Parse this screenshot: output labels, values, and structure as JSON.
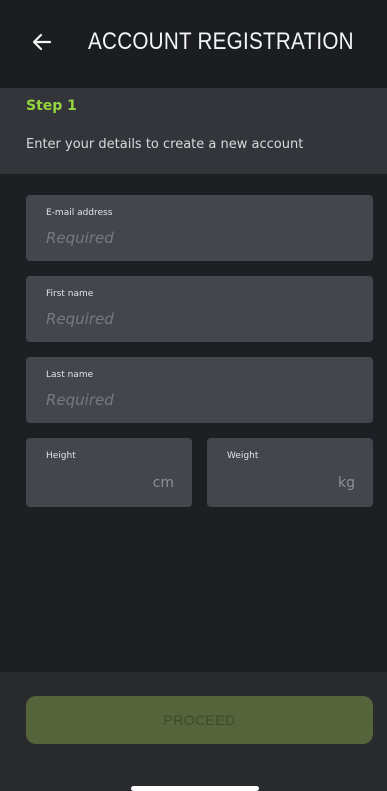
{
  "header": {
    "title": "ACCOUNT REGISTRATION",
    "back_icon": "arrow-left-icon"
  },
  "step": {
    "title": "Step 1",
    "description": "Enter your details to create a new account"
  },
  "form": {
    "email": {
      "label": "E-mail address",
      "placeholder": "Required"
    },
    "first_name": {
      "label": "First name",
      "placeholder": "Required"
    },
    "last_name": {
      "label": "Last name",
      "placeholder": "Required"
    },
    "height": {
      "label": "Height",
      "unit": "cm"
    },
    "weight": {
      "label": "Weight",
      "unit": "kg"
    }
  },
  "actions": {
    "proceed_label": "PROCEED"
  },
  "colors": {
    "accent": "#96d53e",
    "background": "#1e1f22",
    "field": "#44464e",
    "button_disabled": "#55643a"
  }
}
